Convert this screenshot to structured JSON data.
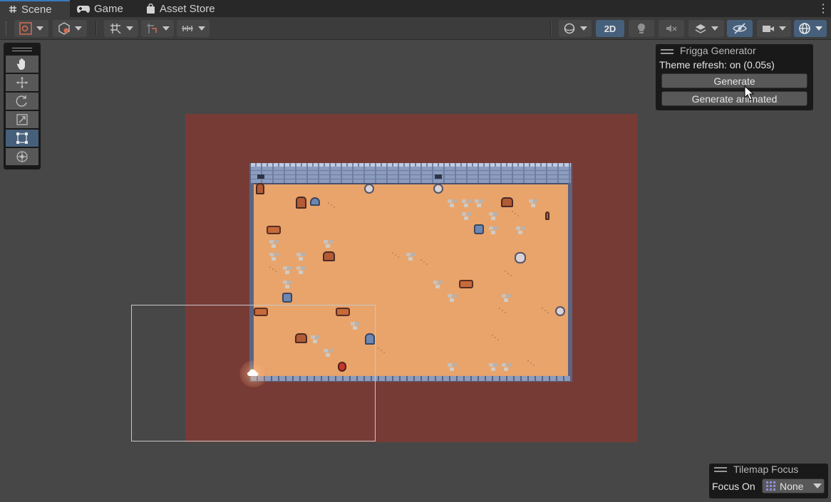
{
  "tabs": [
    {
      "label": "Scene",
      "icon": "hash-icon",
      "active": true
    },
    {
      "label": "Game",
      "icon": "gamepad-icon",
      "active": false
    },
    {
      "label": "Asset Store",
      "icon": "shopping-bag-icon",
      "active": false
    }
  ],
  "toolbar": {
    "mode_2d_label": "2D",
    "accent_color": "#46607c"
  },
  "frigga": {
    "title": "Frigga Generator",
    "status": "Theme refresh: on (0.05s)",
    "generate_label": "Generate",
    "generate_animated_label": "Generate animated"
  },
  "tilemap_focus": {
    "title": "Tilemap Focus",
    "focus_label": "Focus On",
    "focus_value": "None"
  },
  "colors": {
    "camera_background": "#773b36",
    "floor": "#e8a46b",
    "wall": "#8c9cbf"
  }
}
